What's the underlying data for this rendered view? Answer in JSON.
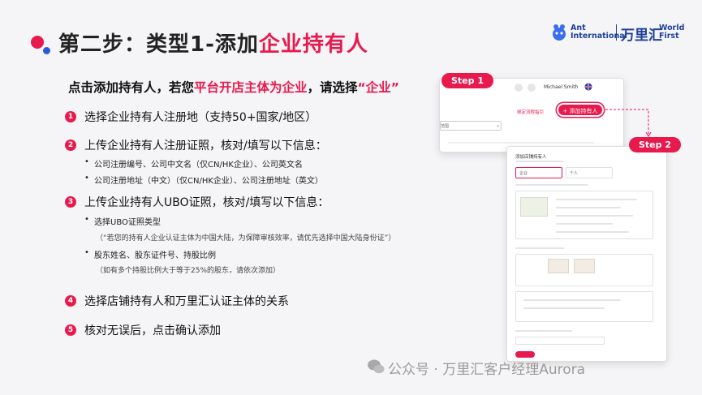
{
  "header": {
    "title_prefix": "第二步：类型1-添加",
    "title_highlight": "企业持有人"
  },
  "logo": {
    "ant_line1": "Ant",
    "ant_line2": "International",
    "brand_cn": "万里汇",
    "brand_en1": "World",
    "brand_en2": "First"
  },
  "intro": {
    "part1": "点击添加持有人，若您",
    "highlight": "平台开店主体为企业",
    "part2": "，请选择",
    "quote": "“企业”"
  },
  "steps": [
    {
      "num": "1",
      "text": "选择企业持有人注册地（支持50+国家/地区）"
    },
    {
      "num": "2",
      "text": "上传企业持有人注册证照，核对/填写以下信息："
    },
    {
      "num": "3",
      "text": "上传企业持有人UBO证照，核对/填写以下信息："
    },
    {
      "num": "4",
      "text": "选择店铺持有人和万里汇认证主体的关系"
    },
    {
      "num": "5",
      "text": "核对无误后，点击确认添加"
    }
  ],
  "step2_items": [
    "公司注册编号、公司中文名（仅CN/HK企业）、公司英文名",
    "公司注册地址（中文）（仅CN/HK企业）、公司注册地址（英文）"
  ],
  "step3_items": [
    "选择UBO证照类型",
    "（“若您的持有人企业认证主体为中国大陆，为保障审核效率，请优先选择中国大陆身份证”）",
    "股东姓名、股东证件号、持股比例",
    "（如有多个持股比例大于等于25%的股东，请依次添加）"
  ],
  "screenshot1": {
    "badge": "Step 1",
    "user_name": "Michael Smith",
    "link_text": "绑定流程指引",
    "add_button": "+ 添加持有人",
    "select_hint": "范围"
  },
  "screenshot2": {
    "badge": "Step 2",
    "section_title": "添加店铺持有人",
    "option_company": "企业",
    "option_person": "个人"
  },
  "watermark": {
    "text": "公众号 · 万里汇客户经理Aurora"
  },
  "colors": {
    "accent": "#e8194d",
    "brand_blue": "#1d3f9c",
    "background": "#f5f5f7"
  }
}
